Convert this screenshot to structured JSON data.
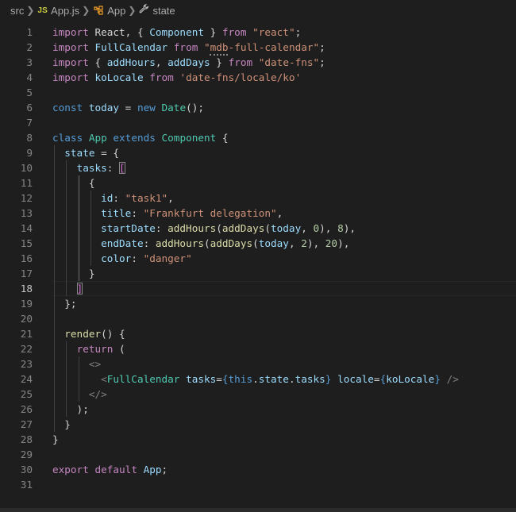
{
  "breadcrumbs": {
    "folder": "src",
    "file_badge": "JS",
    "file": "App.js",
    "class_name": "App",
    "member": "state"
  },
  "editor": {
    "active_line": 18,
    "lines": [
      {
        "n": "1",
        "tokens": [
          [
            "kw",
            "import"
          ],
          [
            "txt",
            " React, { "
          ],
          [
            "var",
            "Component"
          ],
          [
            "txt",
            " } "
          ],
          [
            "kw",
            "from"
          ],
          [
            "txt",
            " "
          ],
          [
            "str",
            "\"react\""
          ],
          [
            "txt",
            ";"
          ]
        ]
      },
      {
        "n": "2",
        "tokens": [
          [
            "kw",
            "import"
          ],
          [
            "txt",
            " "
          ],
          [
            "var",
            "FullCalendar"
          ],
          [
            "txt",
            " "
          ],
          [
            "kw",
            "from"
          ],
          [
            "txt",
            " "
          ],
          [
            "str",
            "\"mdb-full-calendar\""
          ],
          [
            "txt",
            ";"
          ]
        ]
      },
      {
        "n": "3",
        "tokens": [
          [
            "kw",
            "import"
          ],
          [
            "txt",
            " { "
          ],
          [
            "var",
            "addHours"
          ],
          [
            "txt",
            ", "
          ],
          [
            "var",
            "addDays"
          ],
          [
            "txt",
            " } "
          ],
          [
            "kw",
            "from"
          ],
          [
            "txt",
            " "
          ],
          [
            "str",
            "\"date-fns\""
          ],
          [
            "txt",
            ";"
          ]
        ]
      },
      {
        "n": "4",
        "tokens": [
          [
            "kw",
            "import"
          ],
          [
            "txt",
            " "
          ],
          [
            "var",
            "koLocale"
          ],
          [
            "txt",
            " "
          ],
          [
            "kw",
            "from"
          ],
          [
            "txt",
            " "
          ],
          [
            "str",
            "'date-fns/locale/ko'"
          ]
        ]
      },
      {
        "n": "5",
        "tokens": []
      },
      {
        "n": "6",
        "tokens": [
          [
            "stor",
            "const"
          ],
          [
            "txt",
            " "
          ],
          [
            "var",
            "today"
          ],
          [
            "txt",
            " = "
          ],
          [
            "stor",
            "new"
          ],
          [
            "txt",
            " "
          ],
          [
            "cls",
            "Date"
          ],
          [
            "txt",
            "();"
          ]
        ]
      },
      {
        "n": "7",
        "tokens": []
      },
      {
        "n": "8",
        "tokens": [
          [
            "stor",
            "class"
          ],
          [
            "txt",
            " "
          ],
          [
            "cls",
            "App"
          ],
          [
            "txt",
            " "
          ],
          [
            "stor",
            "extends"
          ],
          [
            "txt",
            " "
          ],
          [
            "cls",
            "Component"
          ],
          [
            "txt",
            " {"
          ]
        ]
      },
      {
        "n": "9",
        "tokens": [
          [
            "txt",
            "  "
          ],
          [
            "var",
            "state"
          ],
          [
            "txt",
            " = {"
          ]
        ]
      },
      {
        "n": "10",
        "tokens": [
          [
            "txt",
            "    "
          ],
          [
            "var",
            "tasks"
          ],
          [
            "txt",
            ": "
          ],
          [
            "brk2",
            "["
          ]
        ]
      },
      {
        "n": "11",
        "tokens": [
          [
            "txt",
            "      {"
          ]
        ]
      },
      {
        "n": "12",
        "tokens": [
          [
            "txt",
            "        "
          ],
          [
            "var",
            "id"
          ],
          [
            "txt",
            ": "
          ],
          [
            "str",
            "\"task1\""
          ],
          [
            "txt",
            ","
          ]
        ]
      },
      {
        "n": "13",
        "tokens": [
          [
            "txt",
            "        "
          ],
          [
            "var",
            "title"
          ],
          [
            "txt",
            ": "
          ],
          [
            "str",
            "\"Frankfurt delegation\""
          ],
          [
            "txt",
            ","
          ]
        ]
      },
      {
        "n": "14",
        "tokens": [
          [
            "txt",
            "        "
          ],
          [
            "var",
            "startDate"
          ],
          [
            "txt",
            ": "
          ],
          [
            "fn",
            "addHours"
          ],
          [
            "txt",
            "("
          ],
          [
            "fn",
            "addDays"
          ],
          [
            "txt",
            "("
          ],
          [
            "var",
            "today"
          ],
          [
            "txt",
            ", "
          ],
          [
            "num",
            "0"
          ],
          [
            "txt",
            "), "
          ],
          [
            "num",
            "8"
          ],
          [
            "txt",
            "),"
          ]
        ]
      },
      {
        "n": "15",
        "tokens": [
          [
            "txt",
            "        "
          ],
          [
            "var",
            "endDate"
          ],
          [
            "txt",
            ": "
          ],
          [
            "fn",
            "addHours"
          ],
          [
            "txt",
            "("
          ],
          [
            "fn",
            "addDays"
          ],
          [
            "txt",
            "("
          ],
          [
            "var",
            "today"
          ],
          [
            "txt",
            ", "
          ],
          [
            "num",
            "2"
          ],
          [
            "txt",
            "), "
          ],
          [
            "num",
            "20"
          ],
          [
            "txt",
            "),"
          ]
        ]
      },
      {
        "n": "16",
        "tokens": [
          [
            "txt",
            "        "
          ],
          [
            "var",
            "color"
          ],
          [
            "txt",
            ": "
          ],
          [
            "str",
            "\"danger\""
          ]
        ]
      },
      {
        "n": "17",
        "tokens": [
          [
            "txt",
            "      }"
          ]
        ]
      },
      {
        "n": "18",
        "tokens": [
          [
            "txt",
            "    "
          ],
          [
            "brk2",
            "]"
          ]
        ]
      },
      {
        "n": "19",
        "tokens": [
          [
            "txt",
            "  };"
          ]
        ]
      },
      {
        "n": "20",
        "tokens": []
      },
      {
        "n": "21",
        "tokens": [
          [
            "txt",
            "  "
          ],
          [
            "fn",
            "render"
          ],
          [
            "txt",
            "() {"
          ]
        ]
      },
      {
        "n": "22",
        "tokens": [
          [
            "txt",
            "    "
          ],
          [
            "kw",
            "return"
          ],
          [
            "txt",
            " ("
          ]
        ]
      },
      {
        "n": "23",
        "tokens": [
          [
            "txt",
            "      "
          ],
          [
            "tag",
            "<>"
          ]
        ]
      },
      {
        "n": "24",
        "tokens": [
          [
            "txt",
            "        "
          ],
          [
            "tag",
            "<"
          ],
          [
            "cls",
            "FullCalendar"
          ],
          [
            "txt",
            " "
          ],
          [
            "attr",
            "tasks"
          ],
          [
            "txt",
            "="
          ],
          [
            "stor",
            "{"
          ],
          [
            "stor",
            "this"
          ],
          [
            "txt",
            "."
          ],
          [
            "var",
            "state"
          ],
          [
            "txt",
            "."
          ],
          [
            "var",
            "tasks"
          ],
          [
            "stor",
            "}"
          ],
          [
            "txt",
            " "
          ],
          [
            "attr",
            "locale"
          ],
          [
            "txt",
            "="
          ],
          [
            "stor",
            "{"
          ],
          [
            "var",
            "koLocale"
          ],
          [
            "stor",
            "}"
          ],
          [
            "txt",
            " "
          ],
          [
            "tag",
            "/>"
          ]
        ]
      },
      {
        "n": "25",
        "tokens": [
          [
            "txt",
            "      "
          ],
          [
            "tag",
            "</>"
          ]
        ]
      },
      {
        "n": "26",
        "tokens": [
          [
            "txt",
            "    );"
          ]
        ]
      },
      {
        "n": "27",
        "tokens": [
          [
            "txt",
            "  }"
          ]
        ]
      },
      {
        "n": "28",
        "tokens": [
          [
            "txt",
            "}"
          ]
        ]
      },
      {
        "n": "29",
        "tokens": []
      },
      {
        "n": "30",
        "tokens": [
          [
            "kw",
            "export"
          ],
          [
            "txt",
            " "
          ],
          [
            "kw",
            "default"
          ],
          [
            "txt",
            " "
          ],
          [
            "var",
            "App"
          ],
          [
            "txt",
            ";"
          ]
        ]
      },
      {
        "n": "31",
        "tokens": []
      }
    ]
  },
  "colors": {
    "background": "#1e1e1e",
    "keyword": "#c586c0",
    "storage": "#569cd6",
    "variable": "#9cdcfe",
    "string": "#ce9178",
    "class": "#4ec9b0",
    "function": "#dcdcaa",
    "number": "#b5cea8"
  }
}
